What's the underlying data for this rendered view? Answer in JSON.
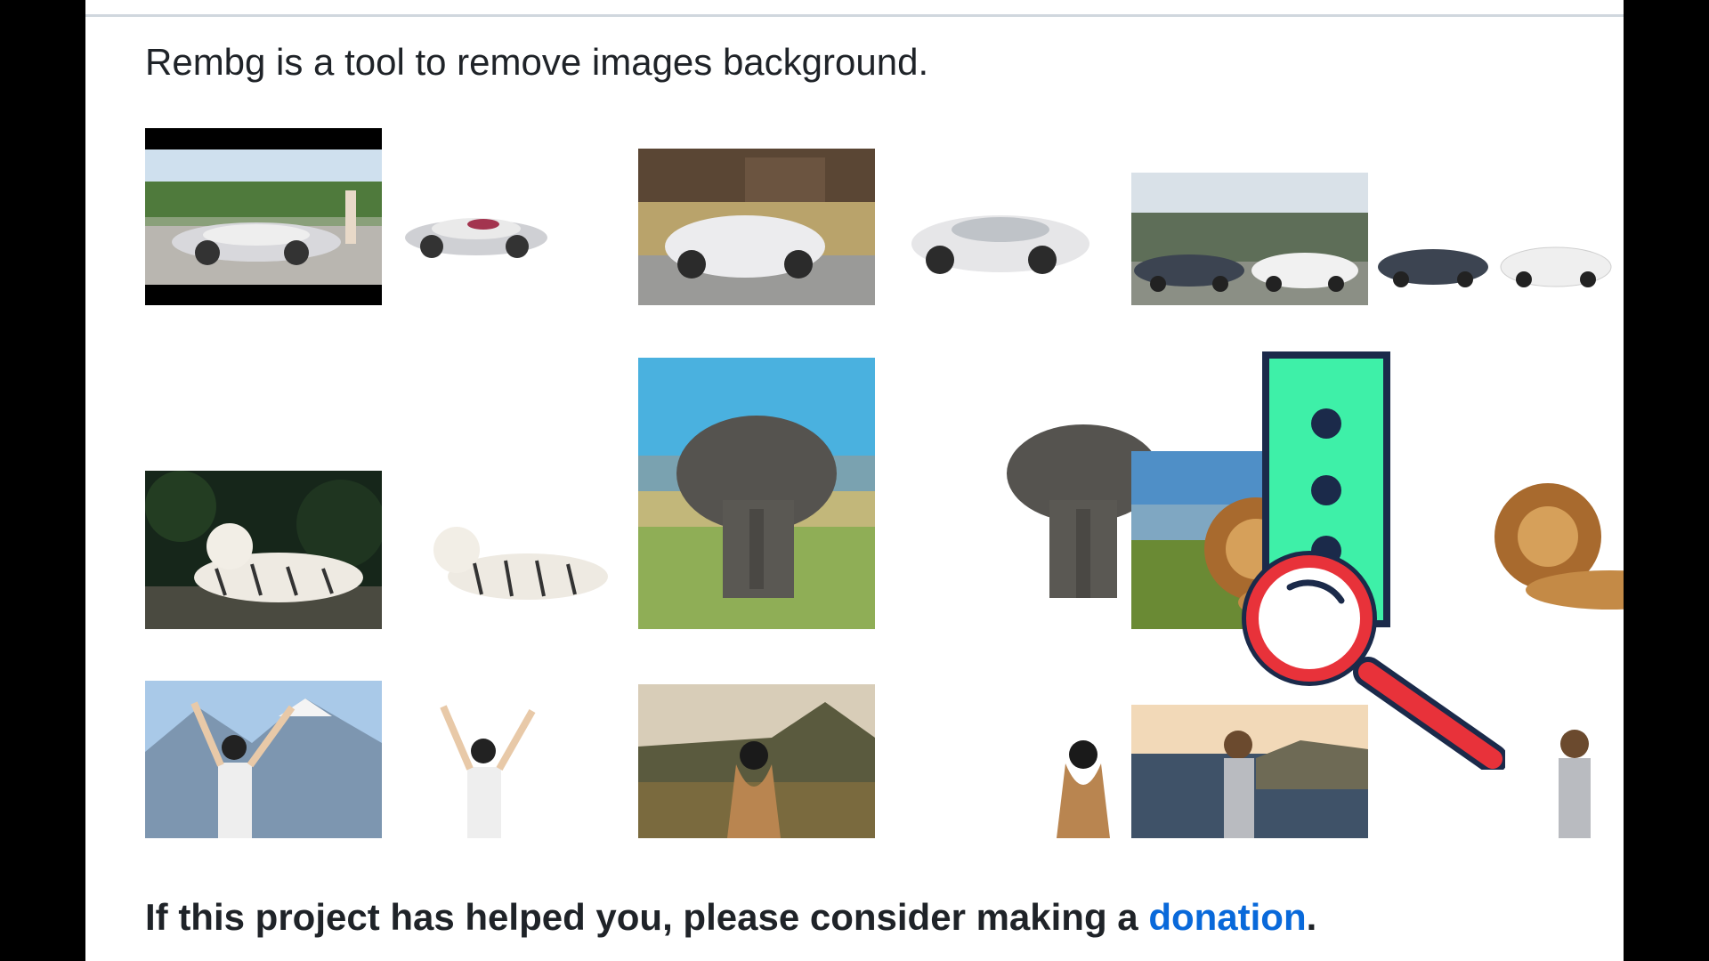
{
  "intro_text": "Rembg is a tool to remove images background.",
  "footer": {
    "prefix": "If this project has helped you, please consider making a ",
    "link_label": "donation",
    "suffix": "."
  },
  "colors": {
    "link": "#0969da",
    "text": "#1f2328",
    "overlay_panel": "#3ef0a8",
    "overlay_magnifier": "#e8323a"
  },
  "gallery": [
    {
      "subject": "concept sports car",
      "kind": "original"
    },
    {
      "subject": "concept sports car",
      "kind": "background removed"
    },
    {
      "subject": "white supercar",
      "kind": "original"
    },
    {
      "subject": "white supercar",
      "kind": "background removed"
    },
    {
      "subject": "two cars",
      "kind": "original"
    },
    {
      "subject": "two cars",
      "kind": "background removed"
    },
    {
      "subject": "white tiger",
      "kind": "original"
    },
    {
      "subject": "white tiger",
      "kind": "background removed"
    },
    {
      "subject": "elephant",
      "kind": "original"
    },
    {
      "subject": "elephant",
      "kind": "background removed"
    },
    {
      "subject": "lion",
      "kind": "original"
    },
    {
      "subject": "lion",
      "kind": "background removed"
    },
    {
      "subject": "woman with raised arms",
      "kind": "original"
    },
    {
      "subject": "woman with raised arms",
      "kind": "background removed"
    },
    {
      "subject": "woman from behind",
      "kind": "original"
    },
    {
      "subject": "woman from behind",
      "kind": "background removed"
    },
    {
      "subject": "woman by the sea",
      "kind": "original"
    },
    {
      "subject": "woman by the sea",
      "kind": "background removed"
    }
  ],
  "overlay": {
    "icon": "magnifier-icon",
    "panel_icon": "vertical-dots-icon"
  }
}
